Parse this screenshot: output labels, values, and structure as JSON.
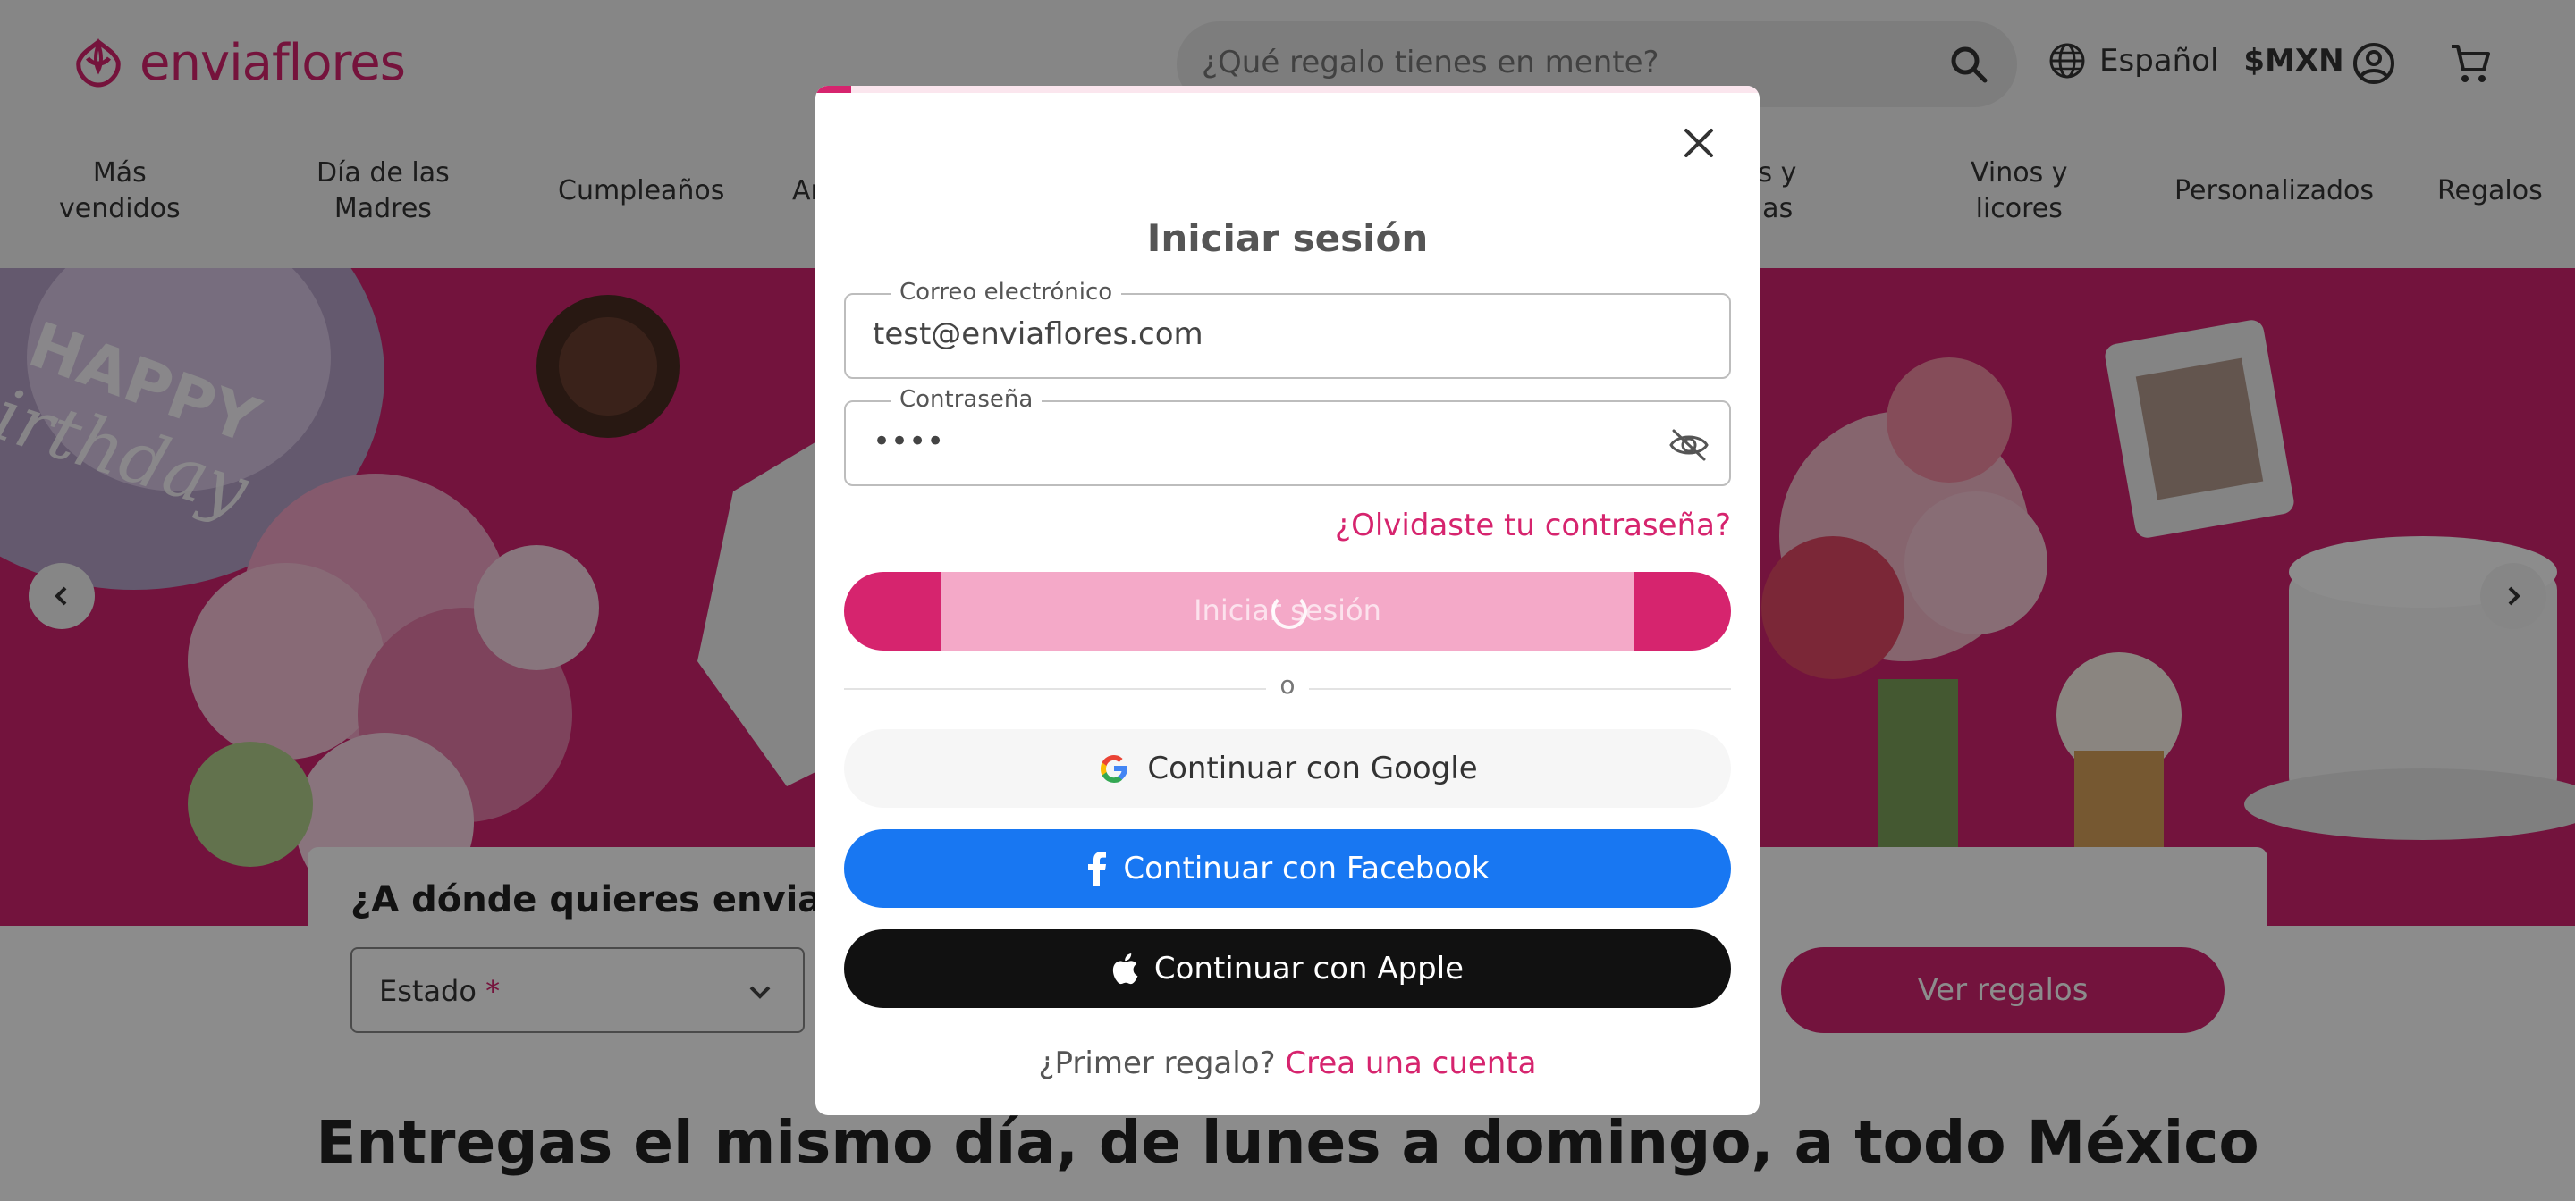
{
  "brand": {
    "name": "enviaflores",
    "color": "#d6246e"
  },
  "header": {
    "search_placeholder": "¿Qué regalo tienes en mente?",
    "language": "Español",
    "currency": "$MXN",
    "icons": [
      "search-icon",
      "globe-icon",
      "account-icon",
      "cart-icon"
    ]
  },
  "nav": {
    "items": [
      {
        "line1": "Más",
        "line2": "vendidos"
      },
      {
        "line1": "Día de las",
        "line2": "Madres"
      },
      {
        "line1": "Cumpleaños",
        "line2": ""
      },
      {
        "line1": "An",
        "line2": ""
      },
      {
        "line1": "es y",
        "line2": "nas"
      },
      {
        "line1": "Vinos y",
        "line2": "licores"
      },
      {
        "line1": "Personalizados",
        "line2": ""
      },
      {
        "line1": "Regalos",
        "line2": ""
      }
    ]
  },
  "hero": {
    "balloon_text_1": "HAPPY",
    "balloon_text_2": "irthday",
    "prev_icon": "chevron-left-icon",
    "next_icon": "chevron-right-icon"
  },
  "destination": {
    "title": "¿A dónde quieres enviar?",
    "state_label": "Estado",
    "required_mark": "*",
    "button_label": "Ver regalos"
  },
  "tagline": "Entregas el mismo día, de lunes a domingo, a todo México",
  "login_modal": {
    "title": "Iniciar sesión",
    "email_label": "Correo electrónico",
    "email_value": "test@enviaflores.com",
    "password_label": "Contraseña",
    "password_value": "••••",
    "forgot_link": "¿Olvidaste tu contraseña?",
    "submit_label": "Iniciar sesión",
    "divider_text": "o",
    "google_label": "Continuar con Google",
    "facebook_label": "Continuar con Facebook",
    "apple_label": "Continuar con Apple",
    "signup_prompt": "¿Primer regalo?",
    "signup_link": "Crea una cuenta"
  }
}
